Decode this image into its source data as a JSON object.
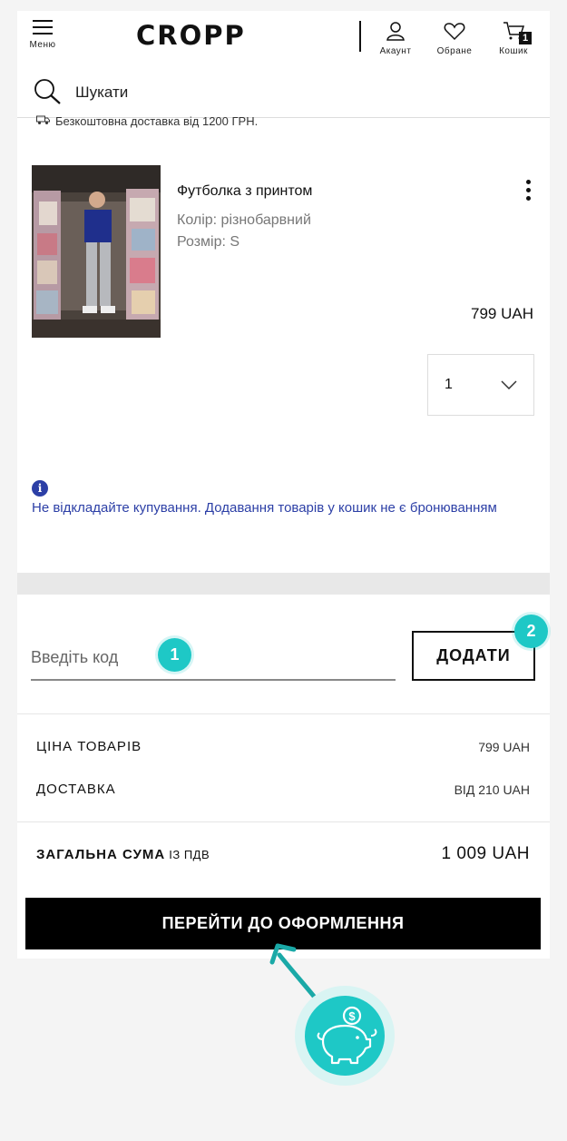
{
  "header": {
    "menu_label": "Меню",
    "logo_text": "CROPP",
    "account_label": "Акаунт",
    "favorites_label": "Обране",
    "cart_label": "Кошик",
    "cart_count": "1"
  },
  "search": {
    "label": "Шукати"
  },
  "free_delivery_text": "Безкоштовна доставка від 1200 ГРН.",
  "product": {
    "name": "Футболка з принтом",
    "color": "Колір: різнобарвний",
    "size": "Розмір: S",
    "price": "799 UAH",
    "quantity": "1"
  },
  "notice": {
    "icon_text": "i",
    "text": "Не відкладайте купування. Додавання товарів у кошик не є бронюванням"
  },
  "promo": {
    "placeholder": "Введіть код",
    "add_button": "ДОДАТИ",
    "step1": "1",
    "step2": "2"
  },
  "summary": {
    "items_label": "ЦІНА ТОВАРІВ",
    "items_value": "799 UAH",
    "delivery_label": "ДОСТАВКА",
    "delivery_value": "ВІД 210 UAH",
    "total_label": "ЗАГАЛЬНА СУМА",
    "total_vat": "ІЗ ПДВ",
    "total_value": "1 009 UAH"
  },
  "checkout_button": "ПЕРЕЙТИ ДО ОФОРМЛЕННЯ",
  "colors": {
    "accent": "#1ec8c6",
    "info": "#2c3fa6",
    "primary": "#000000"
  }
}
